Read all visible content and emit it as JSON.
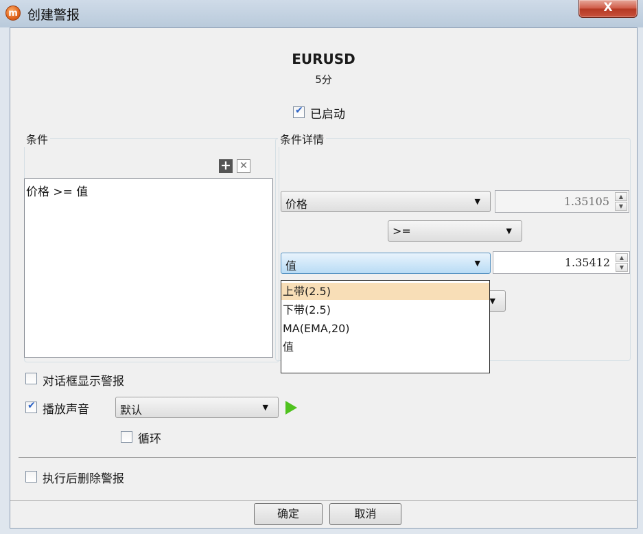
{
  "window": {
    "title": "创建警报",
    "close_label": "X"
  },
  "header": {
    "symbol": "EURUSD",
    "timeframe": "5分",
    "enabled_label": "已启动",
    "enabled_checked": true
  },
  "conditions": {
    "title": "条件",
    "items": [
      "价格 >= 值"
    ]
  },
  "details": {
    "title": "条件详情",
    "left_select": "价格",
    "left_value": "1.35105",
    "operator": ">=",
    "right_select": "值",
    "right_value": "1.35412",
    "dropdown_options": [
      "上带(2.5)",
      "下带(2.5)",
      "MA(EMA,20)",
      "值"
    ],
    "highlighted_option": "上带(2.5)"
  },
  "options": {
    "dialog_label": "对话框显示警报",
    "dialog_checked": false,
    "sound_label": "播放声音",
    "sound_checked": true,
    "sound_select": "默认",
    "loop_label": "循环",
    "loop_checked": false,
    "delete_label": "执行后删除警报",
    "delete_checked": false
  },
  "footer": {
    "ok_label": "确定",
    "cancel_label": "取消"
  },
  "colors": {
    "highlight": "#f8deb7",
    "play": "#4fc21e",
    "check": "#2b62c6"
  }
}
